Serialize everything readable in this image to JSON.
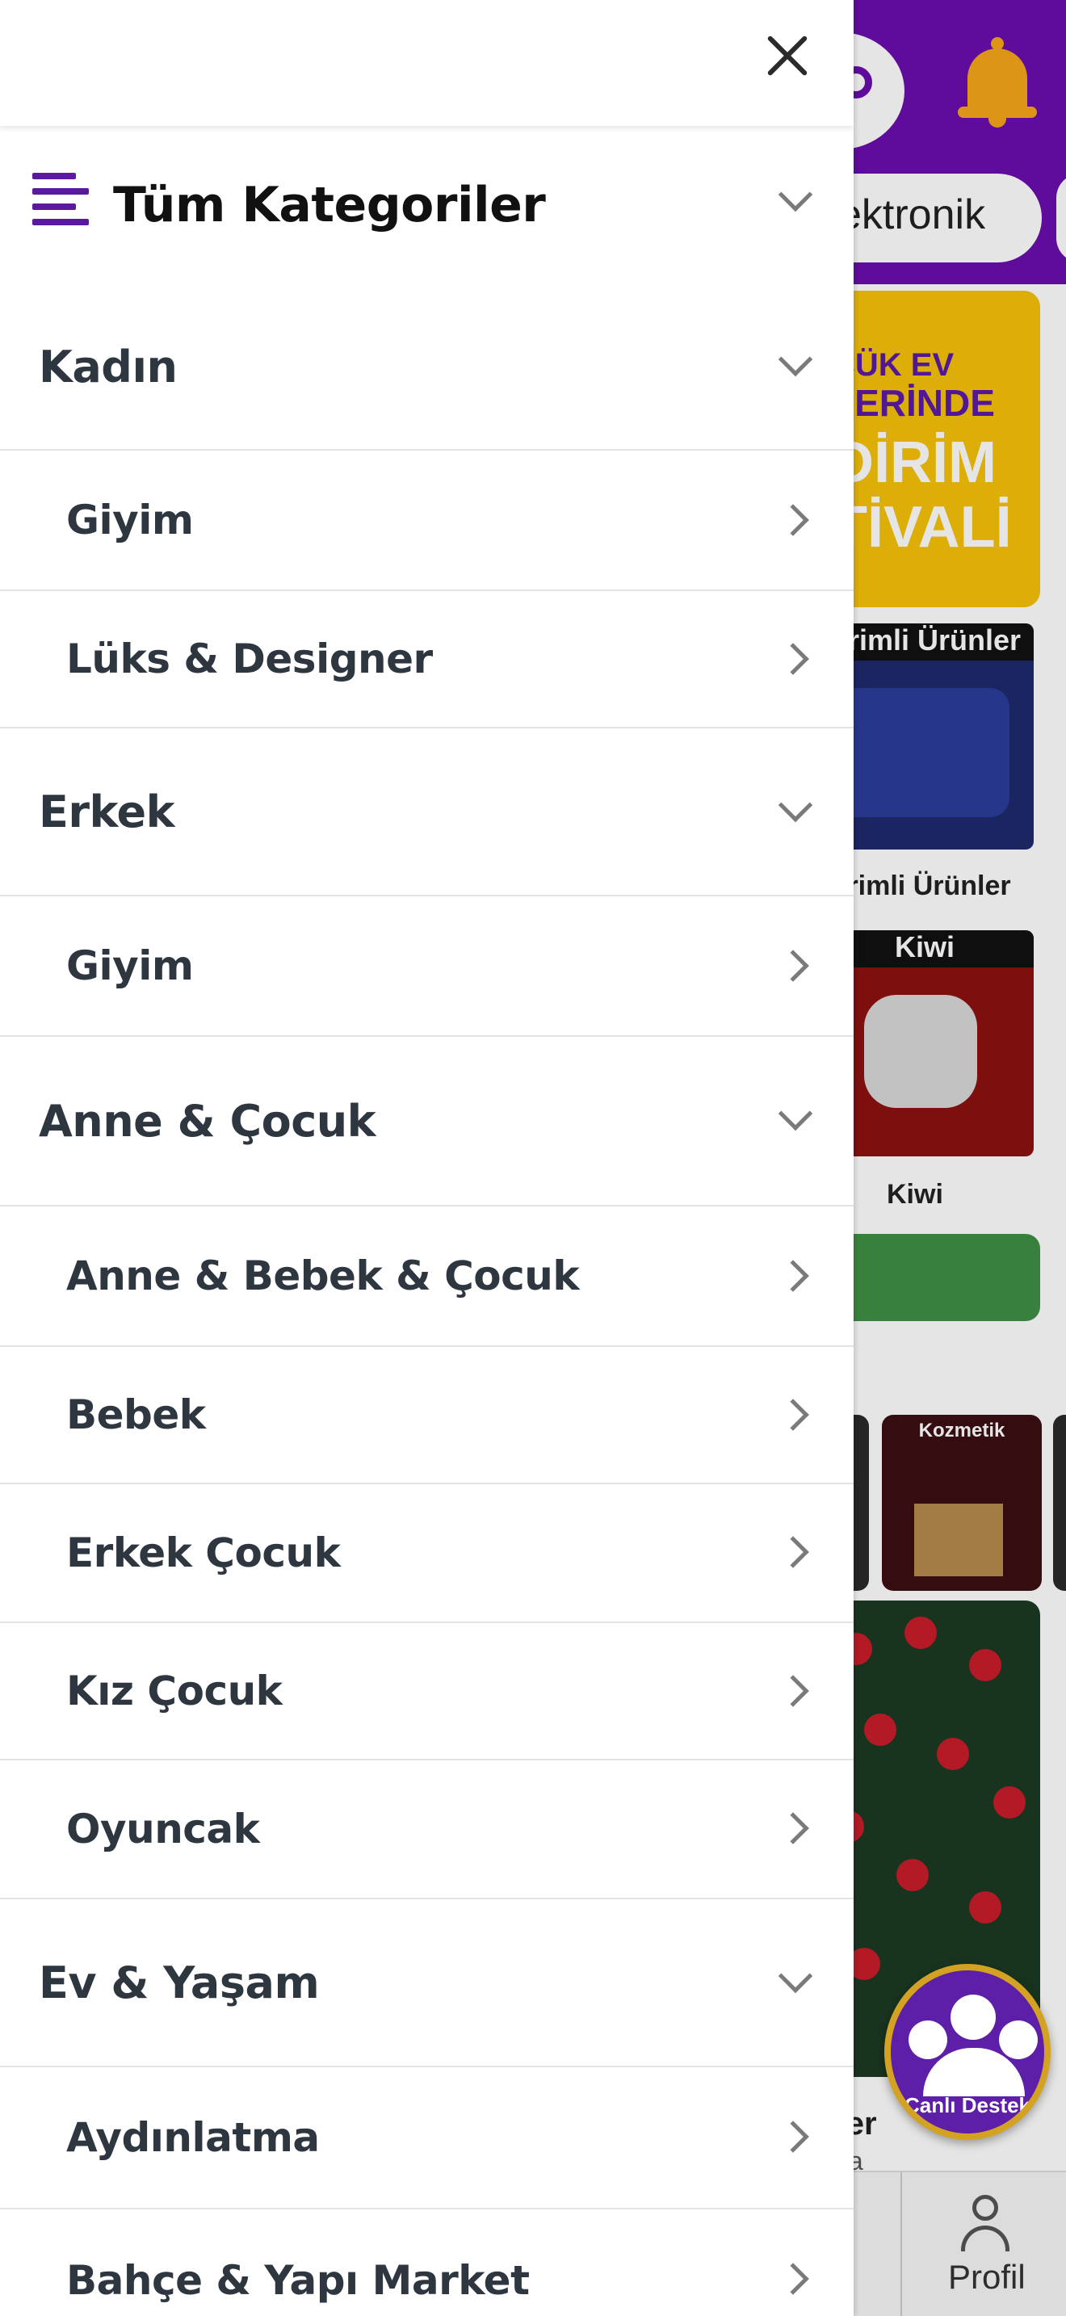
{
  "drawer": {
    "all_categories_label": "Tüm Kategoriler",
    "groups": [
      {
        "label": "Kadın",
        "items": [
          "Giyim",
          "Lüks & Designer"
        ]
      },
      {
        "label": "Erkek",
        "items": [
          "Giyim"
        ]
      },
      {
        "label": "Anne & Çocuk",
        "items": [
          "Anne & Bebek & Çocuk",
          "Bebek",
          "Erkek Çocuk",
          "Kız Çocuk",
          "Oyuncak"
        ]
      },
      {
        "label": "Ev & Yaşam",
        "items": [
          "Aydınlatma",
          "Bahçe & Yapı Market"
        ]
      }
    ]
  },
  "background": {
    "category_chip": "ektronik",
    "banner_lines": [
      "ÇÜK EV",
      "LERİNDE",
      "DİRİM",
      "TİVALİ"
    ],
    "card_1_caption": "irimli Ürünler",
    "card_1_label": "irimli Ürünler",
    "card_2_caption": "Kiwi",
    "card_2_label": "Kiwi",
    "small_card_caption": "Kozmetik",
    "berries_label": "riler",
    "berries_sub": "asla",
    "bottom_nav_profile": "Profil",
    "live_support": "Canlı Destek"
  },
  "colors": {
    "brand_purple": "#6a0dad",
    "menu_icon": "#5b1a9e",
    "text_dark": "#2e3640",
    "divider": "#e3e3e3"
  },
  "icons": {
    "close": "close-icon",
    "menu": "menu-lines-icon",
    "expand": "chevron-down-icon",
    "navigate": "chevron-right-icon"
  }
}
